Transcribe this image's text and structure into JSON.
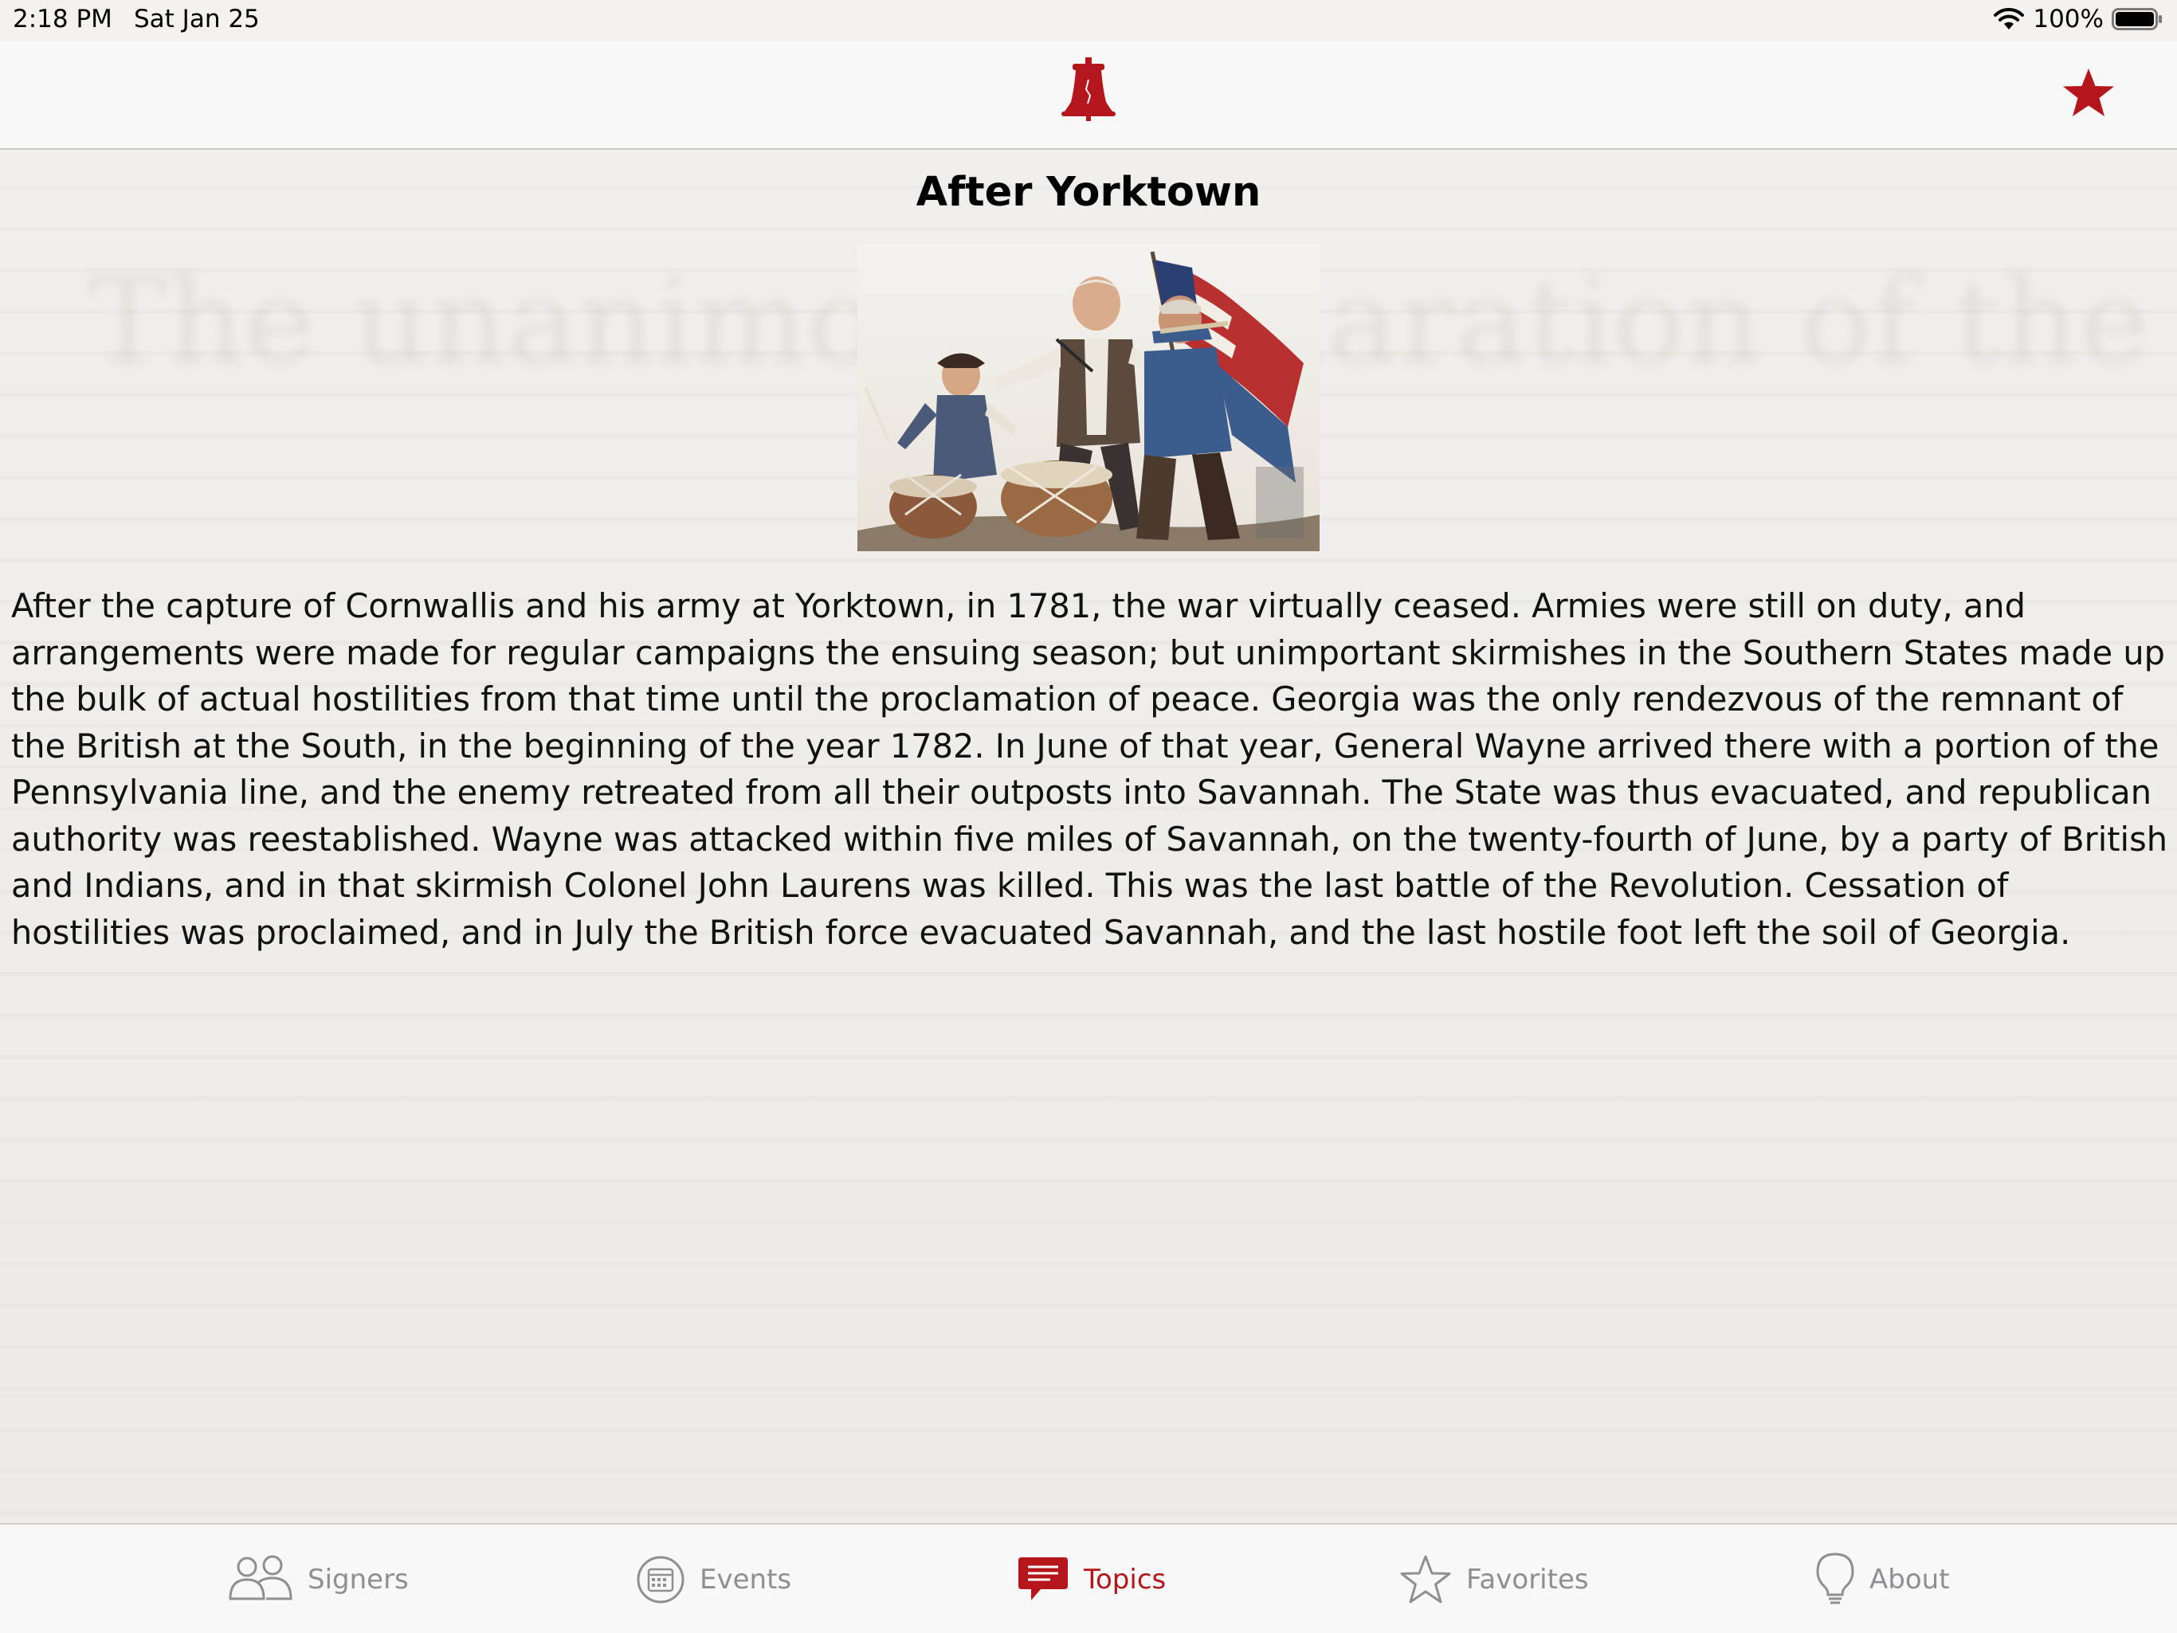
{
  "status_bar": {
    "time": "2:18 PM",
    "date": "Sat Jan 25",
    "battery": "100%"
  },
  "nav": {
    "logo_icon": "liberty-bell-icon",
    "favorite_icon": "star-filled-icon"
  },
  "article": {
    "title": "After Yorktown",
    "image_alt": "Spirit of '76 painting",
    "body": "After the capture of Cornwallis and his army at Yorktown, in 1781, the war virtually ceased. Armies were still on duty, and arrangements were made for regular campaigns the ensuing season; but unimportant skirmishes in the Southern States made up the bulk of actual hostilities from that time until the proclamation of peace. Georgia was the only rendezvous of the remnant of the British at the South, in the beginning of the year 1782. In June of that year, General Wayne arrived there with a portion of the Pennsylvania line, and the enemy retreated from all their outposts into Savannah. The State was thus evacuated, and republican authority was reestablished. Wayne was attacked within five miles of Savannah, on the twenty-fourth of June, by a party of British and Indians, and in that skirmish Colonel John Laurens was killed. This was the last battle of the Revolution. Cessation of hostilities was proclaimed, and in July the British force evacuated Savannah, and the last hostile foot left the soil of Georgia."
  },
  "background_ghost": "The unanimous Declaration of the thirteen united States of America",
  "tabs": [
    {
      "label": "Signers",
      "icon": "people-icon",
      "active": false
    },
    {
      "label": "Events",
      "icon": "calendar-icon",
      "active": false
    },
    {
      "label": "Topics",
      "icon": "chat-bubble-icon",
      "active": true
    },
    {
      "label": "Favorites",
      "icon": "star-outline-icon",
      "active": false
    },
    {
      "label": "About",
      "icon": "lightbulb-icon",
      "active": false
    }
  ],
  "colors": {
    "accent": "#b4161b",
    "inactive": "#8e8e93"
  }
}
